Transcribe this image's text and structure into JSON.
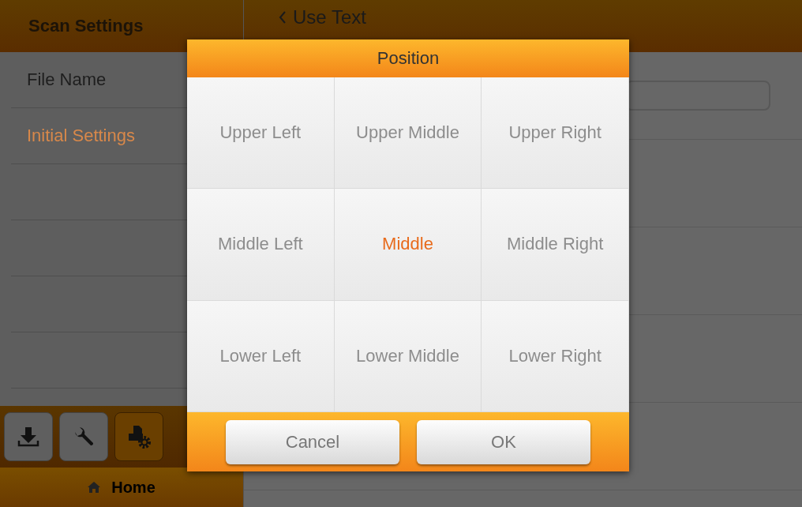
{
  "sidebar": {
    "title": "Scan Settings",
    "items": [
      {
        "label": "File Name",
        "selected": false
      },
      {
        "label": "Initial Settings",
        "selected": true
      }
    ],
    "tools": [
      {
        "kind": "download",
        "selected": false
      },
      {
        "kind": "wrench",
        "selected": false
      },
      {
        "kind": "scanner-settings",
        "selected": true
      }
    ],
    "home": "Home"
  },
  "main": {
    "back": "Use Text"
  },
  "dialog": {
    "title": "Position",
    "options": [
      {
        "label": "Upper Left",
        "selected": false
      },
      {
        "label": "Upper Middle",
        "selected": false
      },
      {
        "label": "Upper Right",
        "selected": false
      },
      {
        "label": "Middle Left",
        "selected": false
      },
      {
        "label": "Middle",
        "selected": true
      },
      {
        "label": "Middle Right",
        "selected": false
      },
      {
        "label": "Lower Left",
        "selected": false
      },
      {
        "label": "Lower Middle",
        "selected": false
      },
      {
        "label": "Lower Right",
        "selected": false
      }
    ],
    "buttons": [
      "Cancel",
      "OK"
    ]
  }
}
